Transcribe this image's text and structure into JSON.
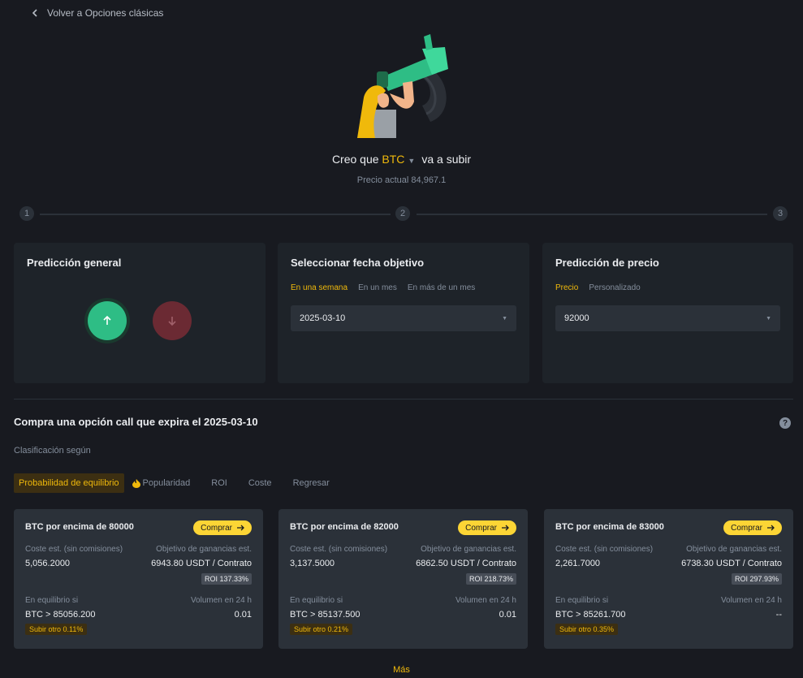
{
  "nav": {
    "back_label": "Volver a Opciones clásicas"
  },
  "header": {
    "prefix": "Creo que",
    "coin": "BTC",
    "suffix": "va a subir",
    "price_text": "Precio actual 84,967.1"
  },
  "stepper": {
    "steps": [
      "1",
      "2",
      "3"
    ]
  },
  "prediction": {
    "title": "Predicción general"
  },
  "date_card": {
    "title": "Seleccionar fecha objetivo",
    "tabs": [
      "En una semana",
      "En un mes",
      "En más de un mes"
    ],
    "selected": "2025-03-10"
  },
  "price_card": {
    "title": "Predicción de precio",
    "tabs": [
      "Precio",
      "Personalizado"
    ],
    "selected": "92000"
  },
  "section": {
    "title": "Compra una opción call que expira el 2025-03-10",
    "help": "?",
    "sort_label": "Clasificación según",
    "sort_tabs": [
      "Probabilidad de equilibrio",
      "Popularidad",
      "ROI",
      "Coste",
      "Regresar"
    ]
  },
  "labels": {
    "cost": "Coste est. (sin comisiones)",
    "target": "Objetivo de ganancias est.",
    "breakeven": "En equilibrio si",
    "volume": "Volumen en 24 h",
    "buy": "Comprar"
  },
  "options": [
    {
      "title": "BTC por encima de 80000",
      "cost": "5,056.2000",
      "target": "6943.80 USDT / Contrato",
      "roi": "ROI 137.33%",
      "breakeven": "BTC > 85056.200",
      "volume": "0.01",
      "rise": "Subir otro 0.11%"
    },
    {
      "title": "BTC por encima de 82000",
      "cost": "3,137.5000",
      "target": "6862.50 USDT / Contrato",
      "roi": "ROI 218.73%",
      "breakeven": "BTC > 85137.500",
      "volume": "0.01",
      "rise": "Subir otro 0.21%"
    },
    {
      "title": "BTC por encima de 83000",
      "cost": "2,261.7000",
      "target": "6738.30 USDT / Contrato",
      "roi": "ROI 297.93%",
      "breakeven": "BTC > 85261.700",
      "volume": "--",
      "rise": "Subir otro 0.35%"
    }
  ],
  "footer": {
    "more_label": "Más"
  },
  "colors": {
    "accent": "#f0b90b",
    "up": "#2ebd85",
    "down": "#6b2a33",
    "background": "#181a20",
    "card": "#1e2329"
  }
}
